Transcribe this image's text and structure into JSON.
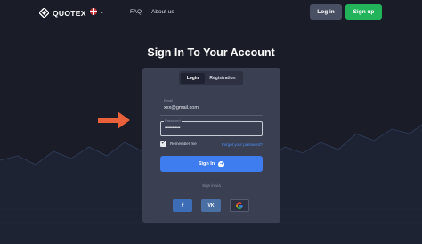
{
  "header": {
    "brand": "QUOTEX",
    "nav": [
      {
        "label": "FAQ"
      },
      {
        "label": "About us"
      }
    ],
    "login_label": "Log in",
    "signup_label": "Sign up"
  },
  "page_title": "Sign In To Your Account",
  "tabs": [
    {
      "label": "Login",
      "active": true
    },
    {
      "label": "Registration",
      "active": false
    }
  ],
  "form": {
    "email_label": "Email",
    "email_value": "xxx@gmail.com",
    "password_label": "Password",
    "password_value": "••••••••••••",
    "remember_label": "Remember me",
    "remember_checked": true,
    "forgot_label": "Forgot your password?",
    "submit_label": "Sign In",
    "signin_via": "Sign in via"
  },
  "social": [
    {
      "label": "f",
      "icon": "facebook-icon"
    },
    {
      "label": "VK",
      "icon": "vk-icon"
    },
    {
      "label": "G",
      "icon": "google-icon"
    }
  ],
  "colors": {
    "background": "#1a1d27",
    "panel": "#3b3f52",
    "accent_blue": "#3d7df0",
    "signup_green": "#23b35b",
    "arrow_orange": "#e8613a"
  }
}
